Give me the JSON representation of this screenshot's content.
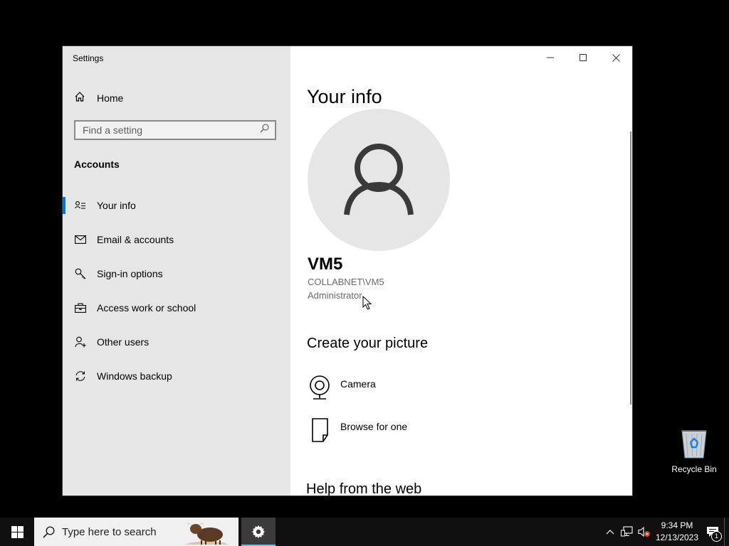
{
  "window": {
    "title": "Settings",
    "caption": {
      "minimize_icon": "minimize-icon",
      "maximize_icon": "maximize-icon",
      "close_icon": "close-icon"
    }
  },
  "sidebar": {
    "home_label": "Home",
    "search_placeholder": "Find a setting",
    "section_title": "Accounts",
    "items": [
      {
        "label": "Your info",
        "icon": "person-card-icon",
        "active": true
      },
      {
        "label": "Email & accounts",
        "icon": "mail-icon",
        "active": false
      },
      {
        "label": "Sign-in options",
        "icon": "key-icon",
        "active": false
      },
      {
        "label": "Access work or school",
        "icon": "briefcase-icon",
        "active": false
      },
      {
        "label": "Other users",
        "icon": "add-person-icon",
        "active": false
      },
      {
        "label": "Windows backup",
        "icon": "sync-icon",
        "active": false
      }
    ]
  },
  "main": {
    "title": "Your info",
    "user": {
      "name": "VM5",
      "account": "COLLABNET\\VM5",
      "role": "Administrator"
    },
    "picture_section": {
      "title": "Create your picture",
      "options": [
        {
          "label": "Camera",
          "icon": "camera-icon"
        },
        {
          "label": "Browse for one",
          "icon": "file-icon"
        }
      ]
    },
    "help_title": "Help from the web"
  },
  "desktop": {
    "recycle_bin_label": "Recycle Bin"
  },
  "taskbar": {
    "search_placeholder": "Type here to search",
    "time": "9:34 PM",
    "date": "12/13/2023",
    "notification_count": "1"
  },
  "colors": {
    "accent": "#0078d7",
    "sidebar_bg": "#e6e6e6",
    "taskbar_bg": "#101010"
  }
}
